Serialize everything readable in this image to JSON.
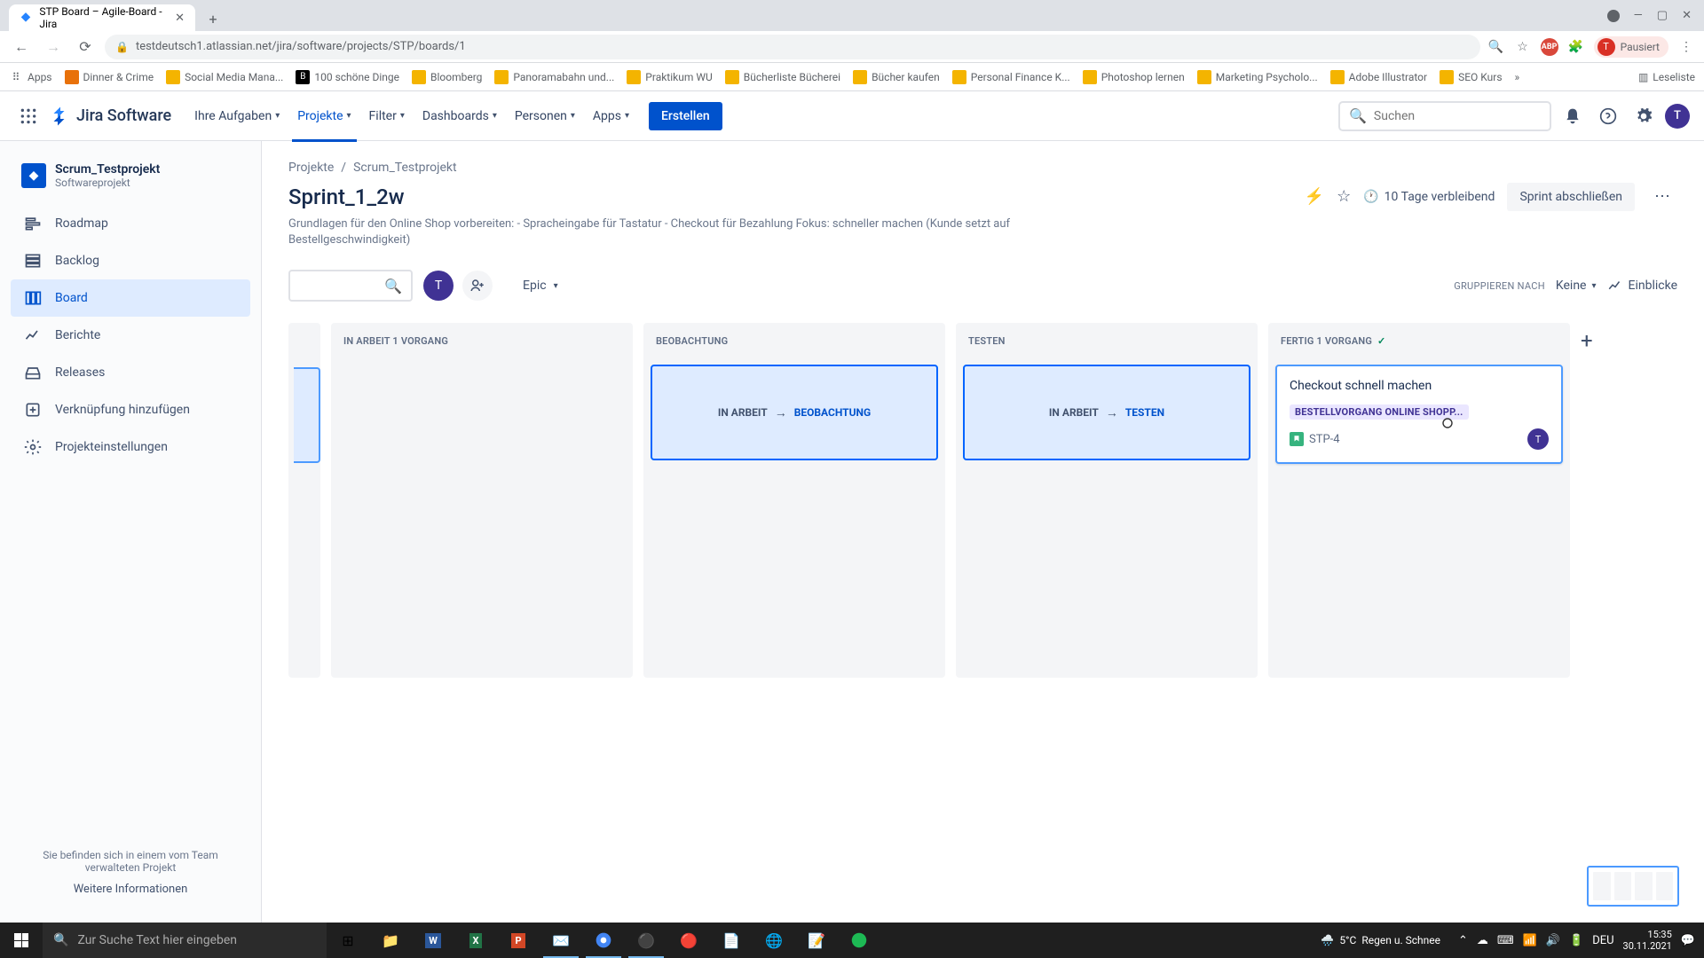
{
  "browser": {
    "tab_title": "STP Board – Agile-Board - Jira",
    "url": "testdeutsch1.atlassian.net/jira/software/projects/STP/boards/1",
    "profile_status": "Pausiert",
    "profile_initial": "T"
  },
  "bookmarks": [
    "Apps",
    "Dinner & Crime",
    "Social Media Mana...",
    "100 schöne Dinge",
    "Bloomberg",
    "Panoramabahn und...",
    "Praktikum WU",
    "Bücherliste Bücherei",
    "Bücher kaufen",
    "Personal Finance K...",
    "Photoshop lernen",
    "Marketing Psycholo...",
    "Adobe Illustrator",
    "SEO Kurs"
  ],
  "reading_list": "Leseliste",
  "jira": {
    "logo_text": "Jira Software",
    "nav": {
      "your_work": "Ihre Aufgaben",
      "projects": "Projekte",
      "filters": "Filter",
      "dashboards": "Dashboards",
      "people": "Personen",
      "apps": "Apps"
    },
    "create": "Erstellen",
    "search_placeholder": "Suchen",
    "user_initial": "T"
  },
  "sidebar": {
    "project_name": "Scrum_Testprojekt",
    "project_type": "Softwareprojekt",
    "items": {
      "roadmap": "Roadmap",
      "backlog": "Backlog",
      "board": "Board",
      "reports": "Berichte",
      "releases": "Releases",
      "add_link": "Verknüpfung hinzufügen",
      "settings": "Projekteinstellungen"
    },
    "footer_text": "Sie befinden sich in einem vom Team verwalteten Projekt",
    "footer_link": "Weitere Informationen"
  },
  "breadcrumb": {
    "projects": "Projekte",
    "project": "Scrum_Testprojekt"
  },
  "sprint": {
    "title": "Sprint_1_2w",
    "goal": "Grundlagen für den Online Shop vorbereiten: - Spracheingabe für Tastatur - Checkout für Bezahlung Fokus: schneller machen (Kunde setzt auf Bestellgeschwindigkeit)",
    "days_remaining": "10 Tage verbleibend",
    "complete": "Sprint abschließen"
  },
  "controls": {
    "epic": "Epic",
    "group_by_label": "GRUPPIEREN NACH",
    "group_by_value": "Keine",
    "insights": "Einblicke"
  },
  "columns": {
    "in_progress": "IN ARBEIT 1 VORGANG",
    "observe": "BEOBACHTUNG",
    "test": "TESTEN",
    "done": "FERTIG 1 VORGANG"
  },
  "transitions": {
    "observe_from": "IN ARBEIT",
    "observe_to": "BEOBACHTUNG",
    "test_from": "IN ARBEIT",
    "test_to": "TESTEN"
  },
  "card": {
    "title": "Checkout schnell machen",
    "epic": "BESTELLVORGANG ONLINE SHOPP...",
    "key": "STP-4",
    "assignee_initial": "T"
  },
  "taskbar": {
    "search_placeholder": "Zur Suche Text hier eingeben",
    "weather_temp": "5°C",
    "weather_text": "Regen u. Schnee",
    "lang": "DEU",
    "time": "15:35",
    "date": "30.11.2021"
  }
}
